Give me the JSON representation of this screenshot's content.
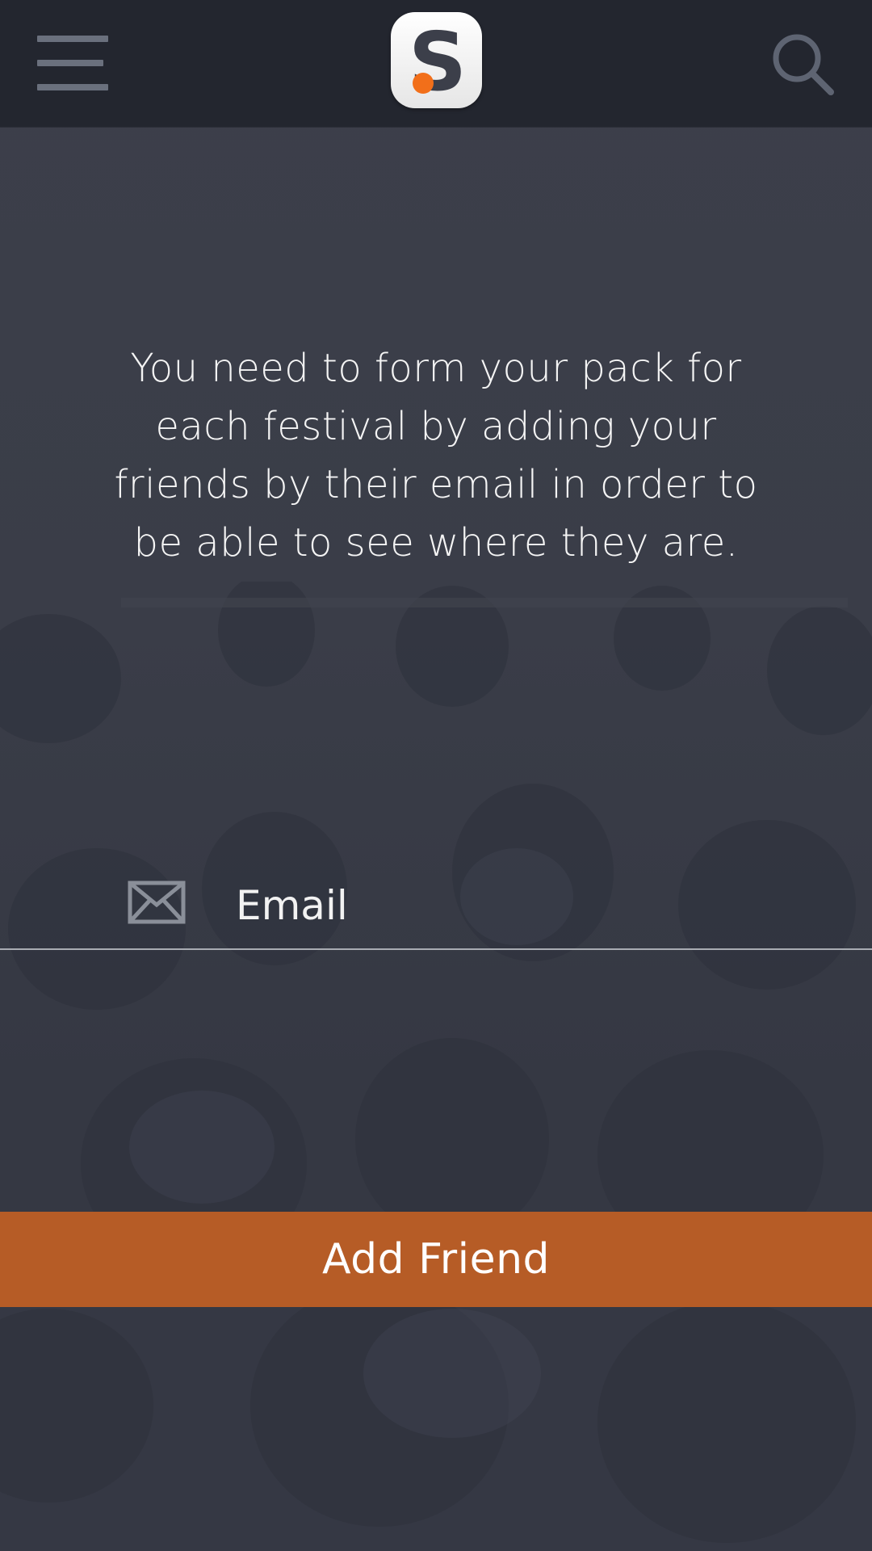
{
  "header": {
    "menu_icon": "hamburger-menu-icon",
    "logo_letter": "S",
    "search_icon": "magnifier-icon",
    "bar_color": "#23262f"
  },
  "main": {
    "message": "You need to form your pack for each festival by adding your friends by their email in order to be able to see where they are."
  },
  "form": {
    "email_icon": "envelope-icon",
    "email_value": "",
    "email_placeholder": "Email",
    "submit_label": "Add Friend"
  },
  "colors": {
    "accent": "#b65c26",
    "logo_dot": "#f26f1a",
    "background": "#3b3e49"
  }
}
